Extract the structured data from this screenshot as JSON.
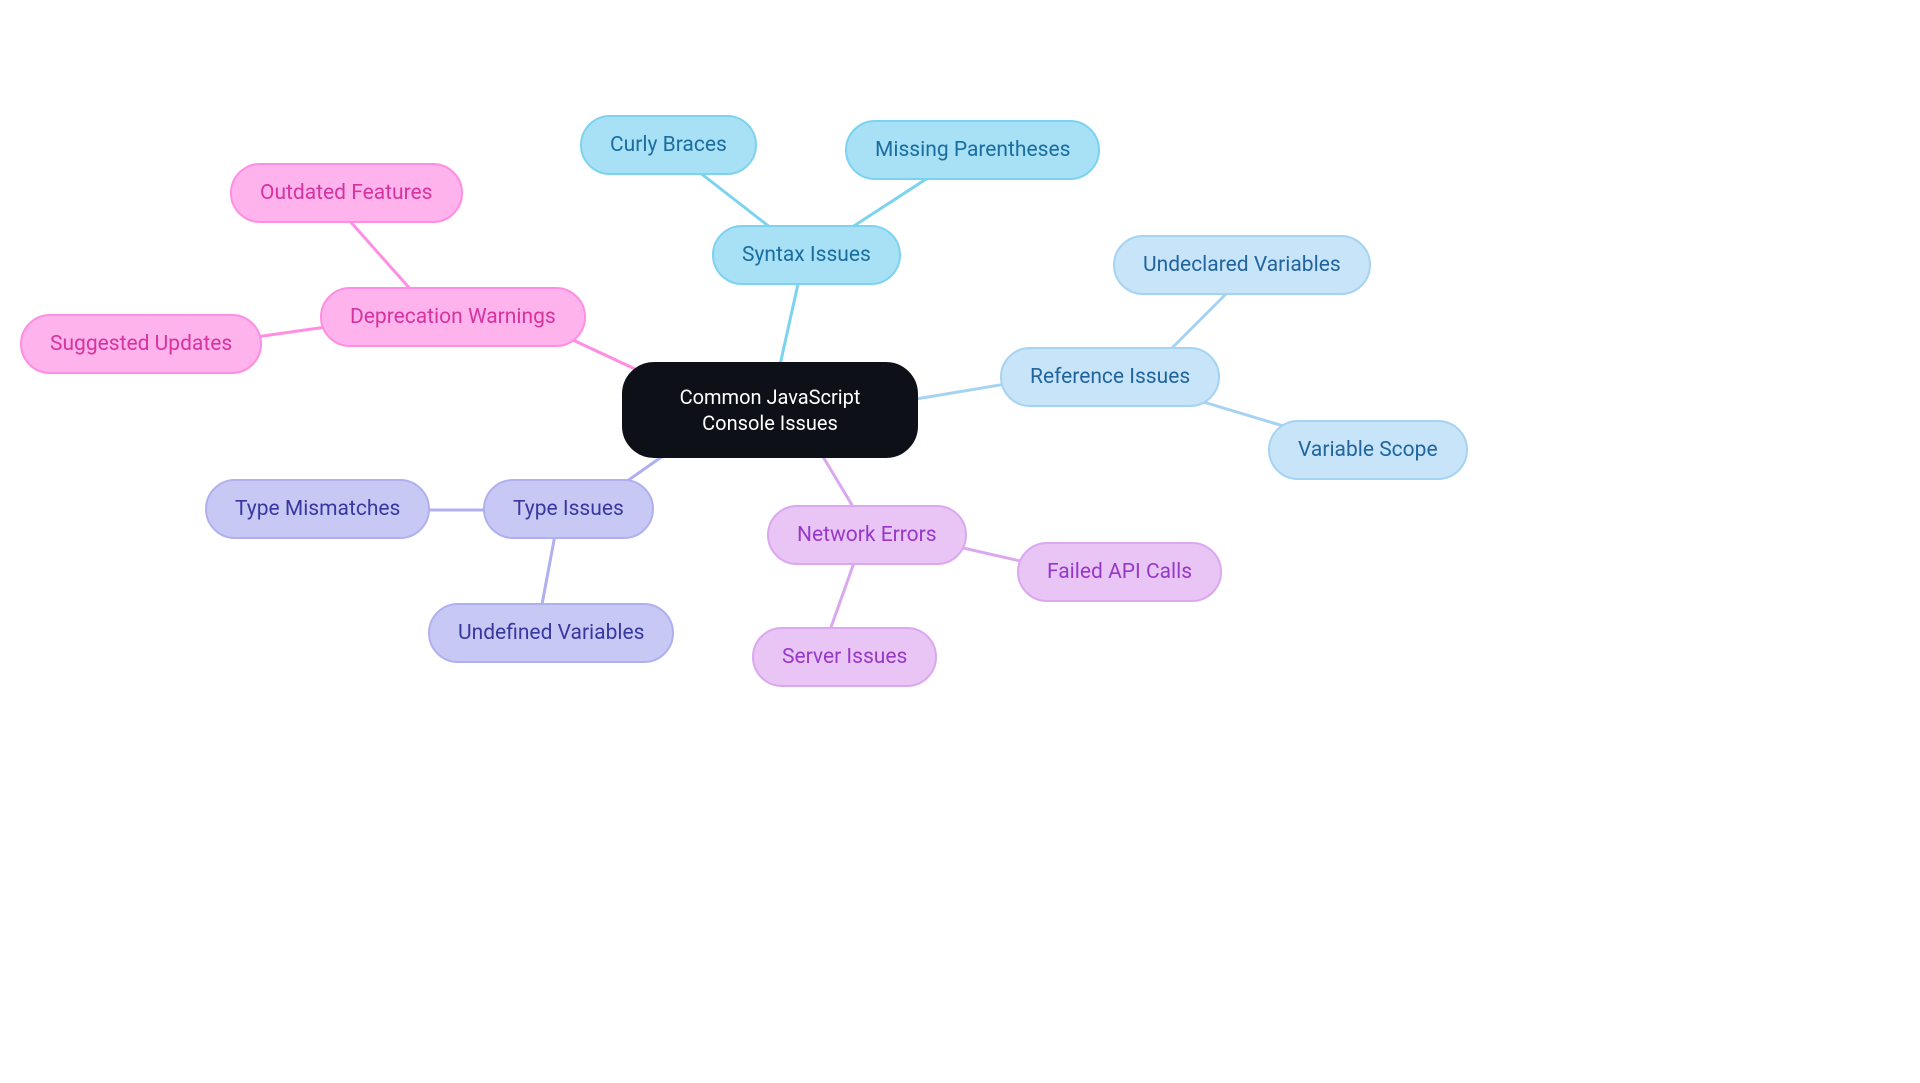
{
  "chart_data": {
    "type": "mindmap",
    "root": {
      "label": "Common JavaScript Console Issues",
      "children": [
        {
          "label": "Deprecation Warnings",
          "color": "pink",
          "children": [
            {
              "label": "Outdated Features"
            },
            {
              "label": "Suggested Updates"
            }
          ]
        },
        {
          "label": "Syntax Issues",
          "color": "cyan",
          "children": [
            {
              "label": "Curly Braces"
            },
            {
              "label": "Missing Parentheses"
            }
          ]
        },
        {
          "label": "Reference Issues",
          "color": "lightblue",
          "children": [
            {
              "label": "Undeclared Variables"
            },
            {
              "label": "Variable Scope"
            }
          ]
        },
        {
          "label": "Type Issues",
          "color": "lavender",
          "children": [
            {
              "label": "Type Mismatches"
            },
            {
              "label": "Undefined Variables"
            }
          ]
        },
        {
          "label": "Network Errors",
          "color": "lightpurple",
          "children": [
            {
              "label": "Failed API Calls"
            },
            {
              "label": "Server Issues"
            }
          ]
        }
      ]
    }
  },
  "nodes": {
    "root": "Common JavaScript Console Issues",
    "deprecation": "Deprecation Warnings",
    "outdated": "Outdated Features",
    "suggested": "Suggested Updates",
    "syntax": "Syntax Issues",
    "curly": "Curly Braces",
    "parens": "Missing Parentheses",
    "reference": "Reference Issues",
    "undeclared": "Undeclared Variables",
    "scope": "Variable Scope",
    "type": "Type Issues",
    "mismatch": "Type Mismatches",
    "undefined": "Undefined Variables",
    "network": "Network Errors",
    "api": "Failed API Calls",
    "server": "Server Issues"
  },
  "colors": {
    "pink": "#ff8de3",
    "cyan": "#7cd3ef",
    "lightblue": "#a5d3f2",
    "lavender": "#b0b0ef",
    "lightpurple": "#dba8ef"
  }
}
